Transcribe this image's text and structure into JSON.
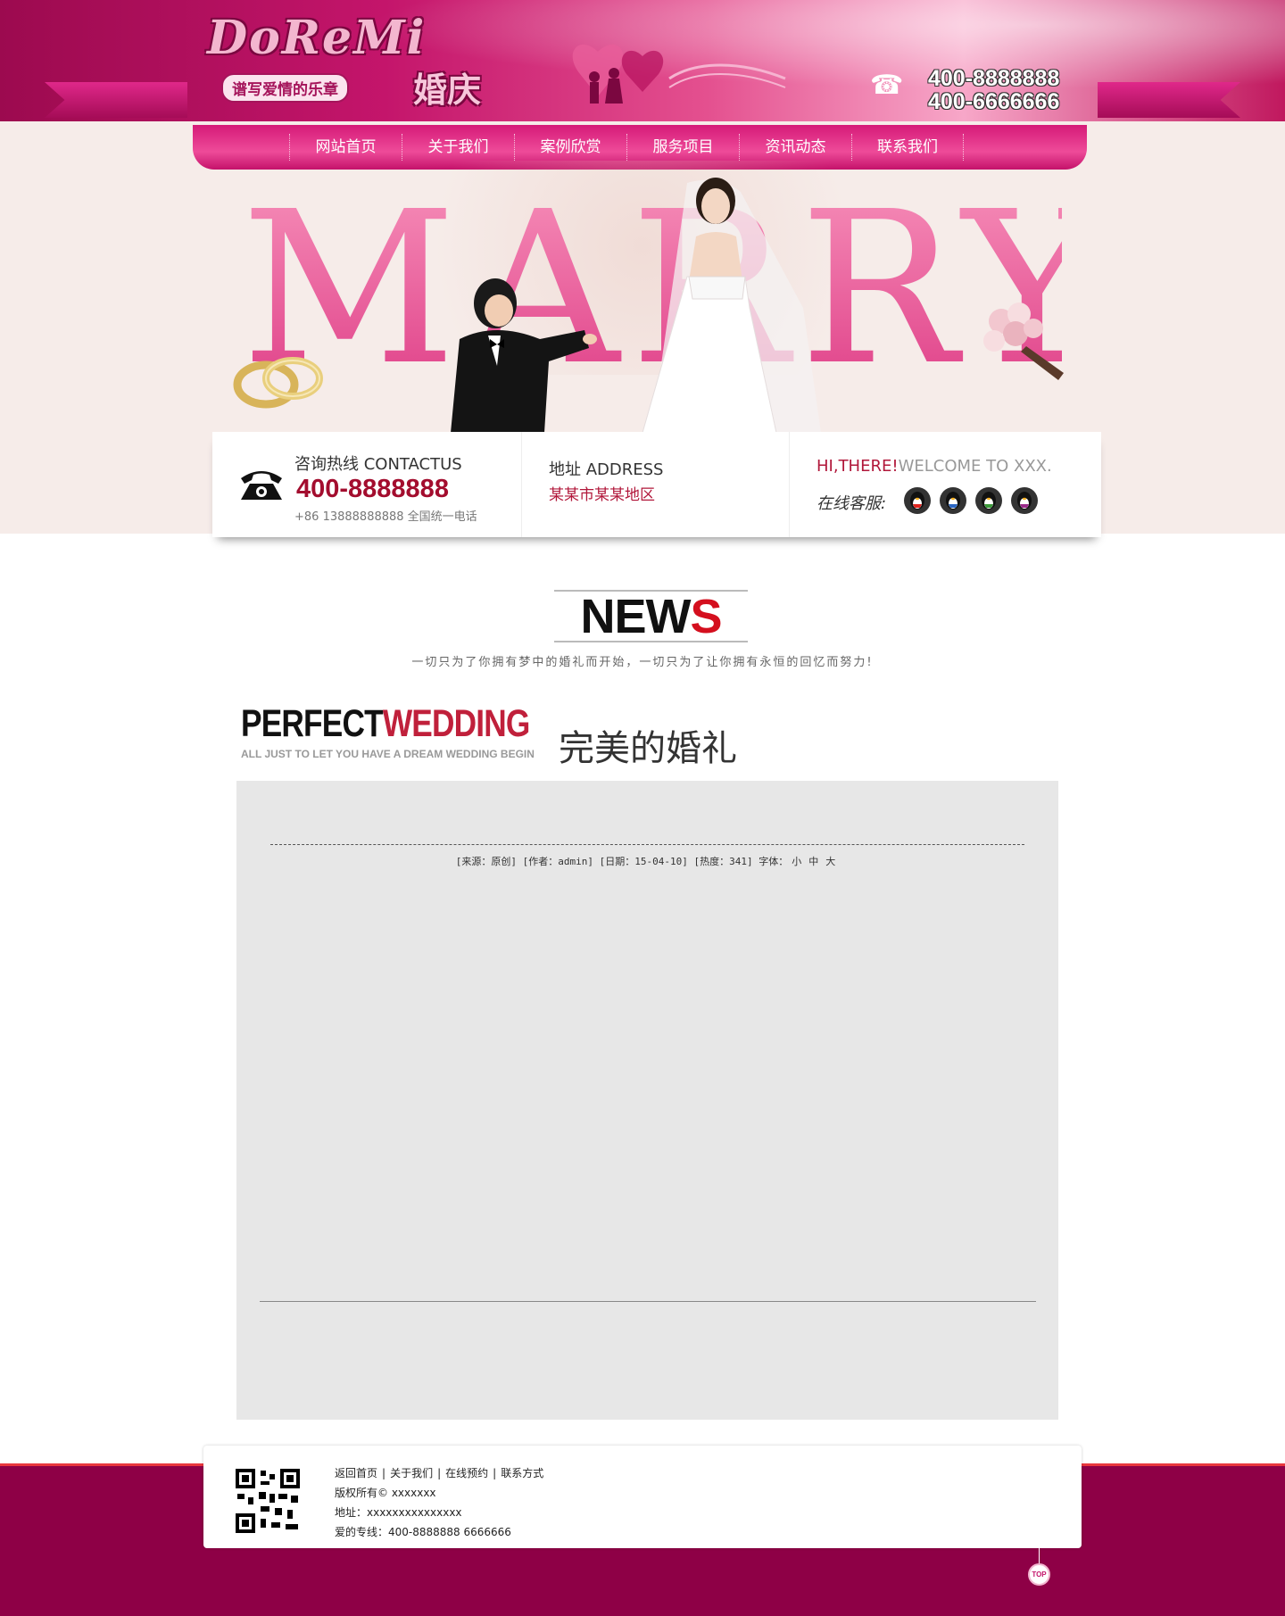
{
  "header": {
    "logo_main": "DoReMi",
    "logo_sub": "谱写爱情的乐章",
    "logo_side": "婚庆",
    "phone_1": "400-8888888",
    "phone_2": "400-6666666"
  },
  "nav": {
    "items": [
      {
        "label": "网站首页"
      },
      {
        "label": "关于我们"
      },
      {
        "label": "案例欣赏"
      },
      {
        "label": "服务项目"
      },
      {
        "label": "资讯动态"
      },
      {
        "label": "联系我们"
      }
    ]
  },
  "hero": {
    "headline": "MARRY"
  },
  "contact": {
    "hotline_title": "咨询热线 CONTACTUS",
    "hotline_number": "400-8888888",
    "hotline_note": "+86 13888888888 全国统一电话",
    "address_title": "地址 ADDRESS",
    "address_value": "某某市某某地区",
    "greeting_red": "HI,THERE!",
    "greeting_grey": "WELCOME TO XXX.",
    "online_service_label": "在线客服:",
    "qq_icons": [
      "qq-icon-red",
      "qq-icon-blue",
      "qq-icon-green",
      "qq-icon-purple"
    ]
  },
  "news": {
    "title_main": "NEW",
    "title_accent": "S",
    "slogan": "一切只为了你拥有梦中的婚礼而开始，一切只为了让你拥有永恒的回忆而努力!"
  },
  "section": {
    "title_dark": "PERFECT",
    "title_red": "WEDDING",
    "subtitle": "ALL JUST  TO LET YOU HAVE A DREAM WEDDING BEGIN",
    "title_cn": "完美的婚礼"
  },
  "article": {
    "meta_prefix": "[来源：原创] [作者：admin] [日期：15-04-10] [热度：341] 字体：",
    "font_small": "小",
    "font_medium": "中",
    "font_large": "大"
  },
  "footer": {
    "links": [
      {
        "label": "返回首页"
      },
      {
        "label": "关于我们"
      },
      {
        "label": "在线预约"
      },
      {
        "label": "联系方式"
      }
    ],
    "link_separator": "|",
    "copyright": "版权所有©  xxxxxxx",
    "address": "地址：xxxxxxxxxxxxxxx",
    "hotline": "爱的专线：400-8888888 6666666",
    "top_label": "TOP"
  },
  "colors": {
    "brand_magenta": "#c4156b",
    "footer_bg": "#8e0046",
    "accent_red": "#b1173a"
  }
}
